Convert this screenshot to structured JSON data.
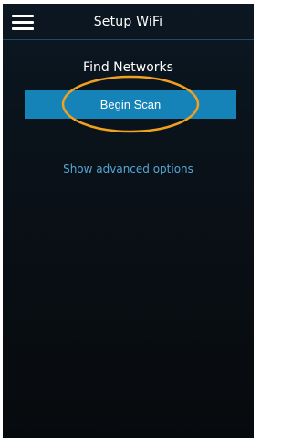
{
  "header": {
    "title": "Setup WiFi",
    "menu_icon": "hamburger-menu-icon"
  },
  "main": {
    "section_title": "Find Networks",
    "scan_button_label": "Begin Scan",
    "advanced_link": "Show advanced options"
  },
  "annotation": {
    "shape": "ellipse",
    "color": "#f0a11f"
  },
  "colors": {
    "background": "#0a1118",
    "accent": "#1583b8",
    "link": "#55a6d4",
    "text": "#ffffff"
  }
}
